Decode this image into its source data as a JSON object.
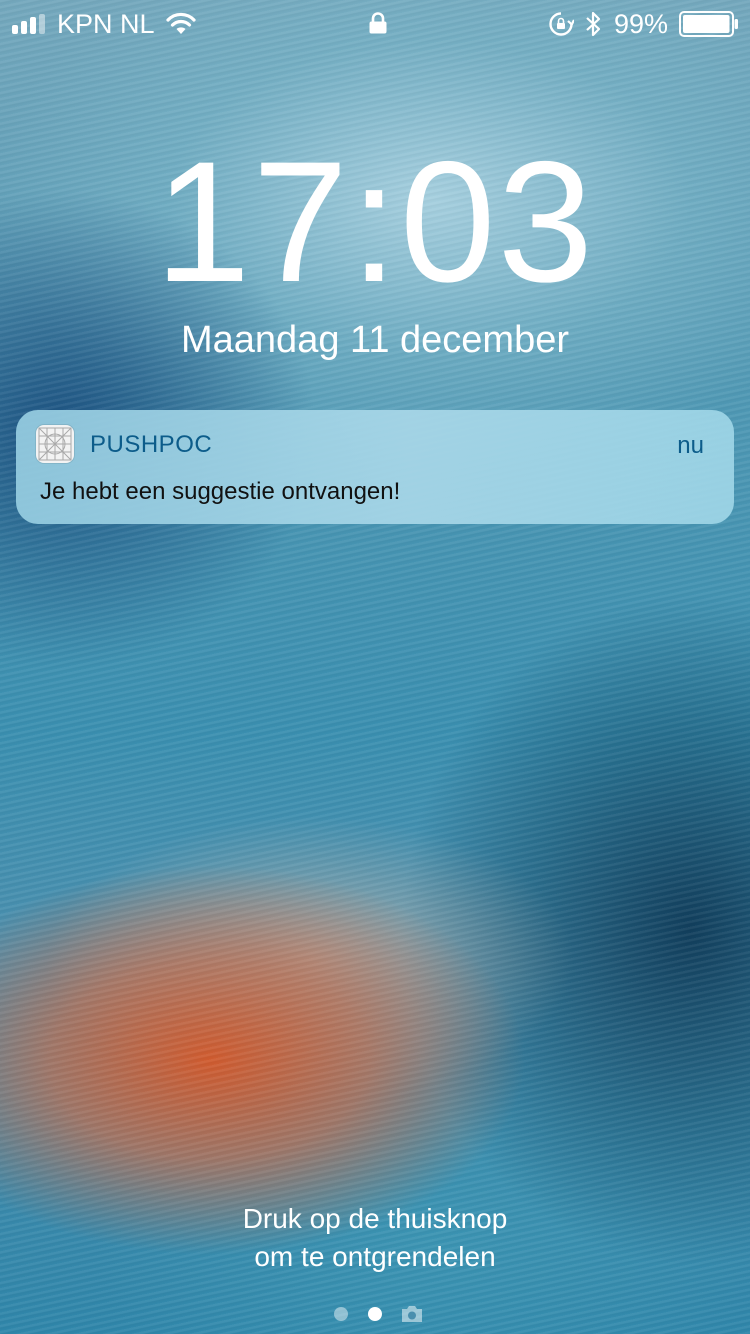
{
  "status_bar": {
    "carrier": "KPN NL",
    "battery_percent": "99%",
    "battery_level": 0.99,
    "icons": [
      "signal-icon",
      "wifi-icon",
      "lock-icon",
      "rotation-lock-icon",
      "bluetooth-icon",
      "battery-icon"
    ]
  },
  "lock_screen": {
    "time": "17:03",
    "date": "Maandag 11 december",
    "unlock_hint_line1": "Druk op de thuisknop",
    "unlock_hint_line2": "om te ontgrendelen"
  },
  "notification": {
    "app_name": "PUSHPOC",
    "time": "nu",
    "message": "Je hebt een suggestie ontvangen!",
    "accent_color": "#0c5c8a"
  },
  "page_indicator": {
    "pages": 2,
    "active_page": 2,
    "trailing_icon": "camera-icon"
  }
}
